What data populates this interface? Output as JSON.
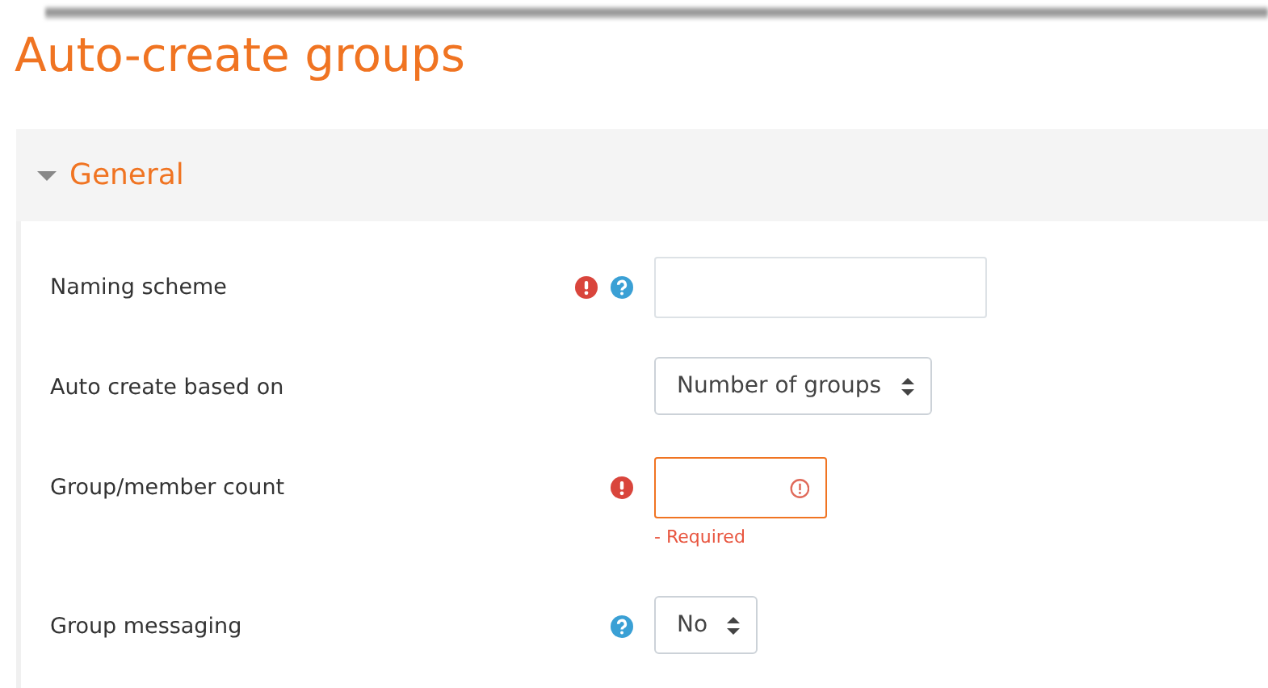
{
  "page_title": "Auto-create groups",
  "section": {
    "label": "General",
    "expanded": true
  },
  "fields": [
    {
      "label": "Naming scheme",
      "required": true,
      "help": true,
      "kind": "text"
    },
    {
      "label": "Auto create based on",
      "required": false,
      "help": false,
      "kind": "select",
      "value": "Number of groups"
    },
    {
      "label": "Group/member count",
      "required": true,
      "help": false,
      "kind": "text",
      "error": "- Required"
    },
    {
      "label": "Group messaging",
      "required": false,
      "help": true,
      "kind": "select",
      "value": "No"
    }
  ]
}
